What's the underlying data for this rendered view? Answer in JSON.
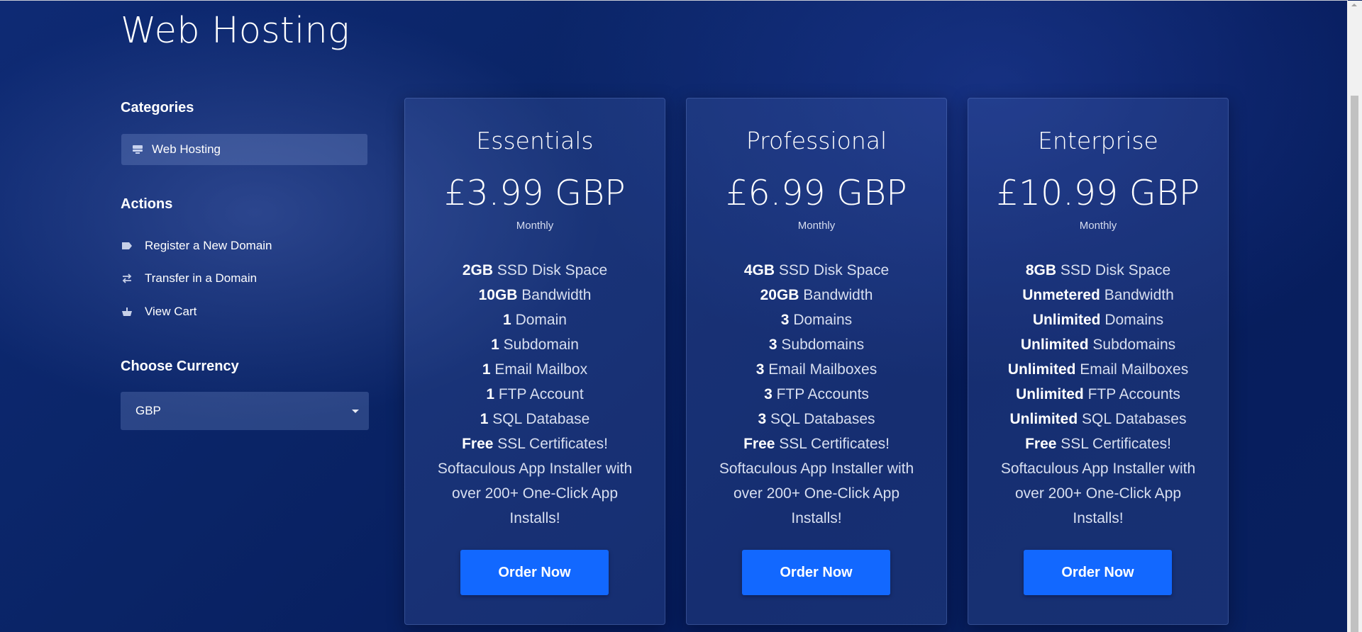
{
  "page": {
    "title": "Web Hosting"
  },
  "sidebar": {
    "categories_heading": "Categories",
    "categories": [
      {
        "label": "Web Hosting",
        "icon": "server-icon"
      }
    ],
    "actions_heading": "Actions",
    "actions": [
      {
        "label": "Register a New Domain",
        "icon": "tag-icon"
      },
      {
        "label": "Transfer in a Domain",
        "icon": "transfer-arrows-icon"
      },
      {
        "label": "View Cart",
        "icon": "cart-icon"
      }
    ],
    "currency_heading": "Choose Currency",
    "currency_selected": "GBP"
  },
  "plans": [
    {
      "name": "Essentials",
      "price": "£3.99 GBP",
      "cycle": "Monthly",
      "features": [
        {
          "bold": "2GB",
          "text": " SSD Disk Space"
        },
        {
          "bold": "10GB",
          "text": " Bandwidth"
        },
        {
          "bold": "1",
          "text": " Domain"
        },
        {
          "bold": "1",
          "text": " Subdomain"
        },
        {
          "bold": "1",
          "text": " Email Mailbox"
        },
        {
          "bold": "1",
          "text": " FTP Account"
        },
        {
          "bold": "1",
          "text": " SQL Database"
        },
        {
          "bold": "Free",
          "text": " SSL Certificates!"
        },
        {
          "bold": "",
          "text": "Softaculous App Installer with"
        },
        {
          "bold": "",
          "text": "over 200+ One-Click App"
        },
        {
          "bold": "",
          "text": "Installs!"
        }
      ],
      "button": "Order Now"
    },
    {
      "name": "Professional",
      "price": "£6.99 GBP",
      "cycle": "Monthly",
      "features": [
        {
          "bold": "4GB",
          "text": " SSD Disk Space"
        },
        {
          "bold": "20GB",
          "text": " Bandwidth"
        },
        {
          "bold": "3",
          "text": " Domains"
        },
        {
          "bold": "3",
          "text": " Subdomains"
        },
        {
          "bold": "3",
          "text": " Email Mailboxes"
        },
        {
          "bold": "3",
          "text": " FTP Accounts"
        },
        {
          "bold": "3",
          "text": " SQL Databases"
        },
        {
          "bold": "Free",
          "text": " SSL Certificates!"
        },
        {
          "bold": "",
          "text": "Softaculous App Installer with"
        },
        {
          "bold": "",
          "text": "over 200+ One-Click App"
        },
        {
          "bold": "",
          "text": "Installs!"
        }
      ],
      "button": "Order Now"
    },
    {
      "name": "Enterprise",
      "price": "£10.99 GBP",
      "cycle": "Monthly",
      "features": [
        {
          "bold": "8GB",
          "text": " SSD Disk Space"
        },
        {
          "bold": "Unmetered",
          "text": " Bandwidth"
        },
        {
          "bold": "Unlimited",
          "text": " Domains"
        },
        {
          "bold": "Unlimited",
          "text": " Subdomains"
        },
        {
          "bold": "Unlimited",
          "text": " Email Mailboxes"
        },
        {
          "bold": "Unlimited",
          "text": " FTP Accounts"
        },
        {
          "bold": "Unlimited",
          "text": " SQL Databases"
        },
        {
          "bold": "Free",
          "text": " SSL Certificates!"
        },
        {
          "bold": "",
          "text": "Softaculous App Installer with"
        },
        {
          "bold": "",
          "text": "over 200+ One-Click App"
        },
        {
          "bold": "",
          "text": "Installs!"
        }
      ],
      "button": "Order Now"
    }
  ],
  "colors": {
    "background": "#0a2466",
    "card": "#1e3a8a",
    "button": "#1268ff",
    "text": "#ffffff"
  }
}
